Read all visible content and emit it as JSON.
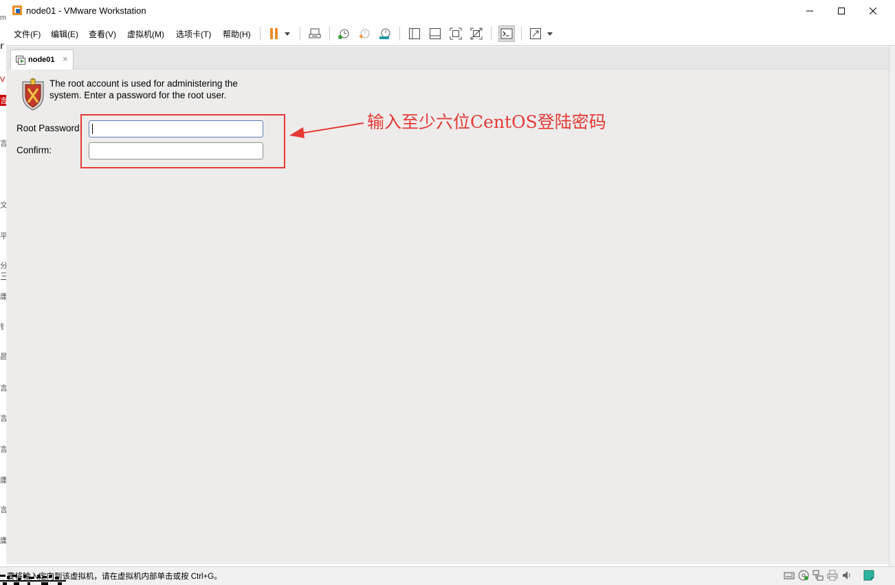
{
  "window": {
    "title": "node01 - VMware Workstation"
  },
  "menu": {
    "items": [
      "文件(F)",
      "编辑(E)",
      "查看(V)",
      "虚拟机(M)",
      "选项卡(T)",
      "帮助(H)"
    ]
  },
  "toolbar": {
    "icons": [
      "pause-icon",
      "dropdown-arrow-icon",
      "send-ctrl-alt-del-icon",
      "snapshot-icon",
      "revert-snapshot-icon",
      "snapshot-manager-icon",
      "show-library-icon",
      "show-thumbnail-icon",
      "fullscreen-icon",
      "unity-icon",
      "console-view-icon",
      "stretch-icon",
      "dropdown-arrow-icon"
    ]
  },
  "tab": {
    "label": "node01",
    "close": "×"
  },
  "console": {
    "message": "The root account is used for administering the system.  Enter a password for the root user.",
    "root_password_label": "Root Password:",
    "confirm_label": "Confirm:",
    "root_password_value": "",
    "confirm_value": "",
    "annotation": "输入至少六位CentOS登陆密码"
  },
  "status": {
    "text": "要将输入定向到该虚拟机，请在虚拟机内部单击或按 Ctrl+G。",
    "icons": [
      "hard-disk-icon",
      "cd-dvd-icon",
      "network-icon",
      "printer-icon",
      "sound-icon",
      "message-icon"
    ]
  },
  "background_strip": {
    "chars": [
      "m",
      "r",
      "V",
      "言",
      "言",
      "文",
      "平",
      "分",
      "三",
      "庸",
      "钅",
      "昌",
      "言",
      "言",
      "言",
      "庸",
      "言",
      "庸"
    ]
  },
  "colors": {
    "accent_red": "#e53935",
    "console_bg": "#edeceb",
    "pause_orange": "#f08a24"
  }
}
